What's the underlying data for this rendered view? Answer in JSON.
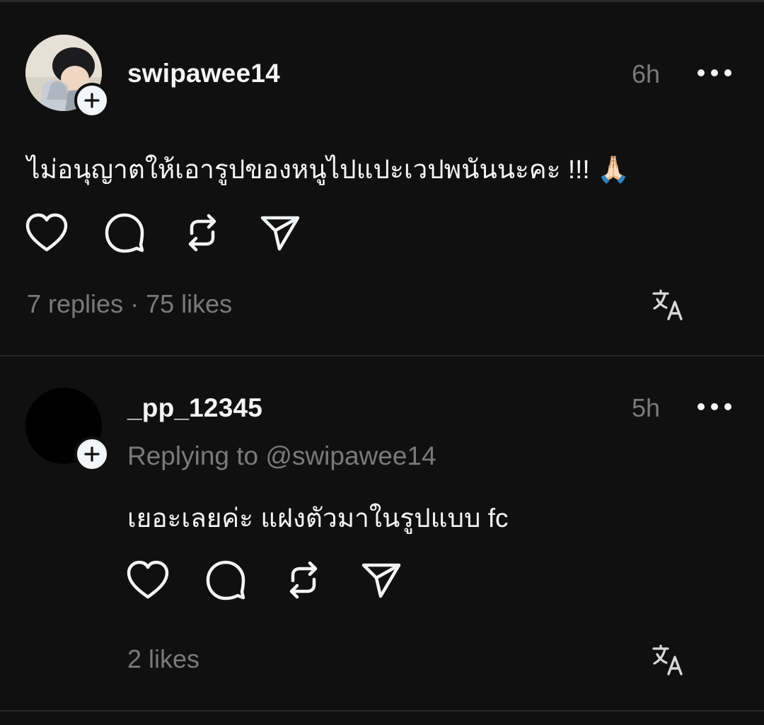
{
  "posts": [
    {
      "username": "swipawee14",
      "time": "6h",
      "text": "ไม่อนุญาตให้เอารูปของหนูไปแปะเวปพนันนะคะ !!! 🙏🏻",
      "stats": "7 replies · 75 likes"
    },
    {
      "username": "_pp_12345",
      "time": "5h",
      "replying_to": "Replying to @swipawee14",
      "text": "เยอะเลยค่ะ แฝงตัวมาในรูปแบบ fc",
      "stats": "2 likes"
    }
  ],
  "icons": {
    "like": "heart-icon",
    "reply": "comment-bubble-icon",
    "repost": "repost-icon",
    "share": "send-icon",
    "translate": "translate-icon",
    "more": "more-horizontal-icon",
    "follow": "plus-icon"
  },
  "colors": {
    "background": "#101010",
    "text": "#f3f5f7",
    "muted": "#7a7a7a",
    "divider": "#262626"
  }
}
